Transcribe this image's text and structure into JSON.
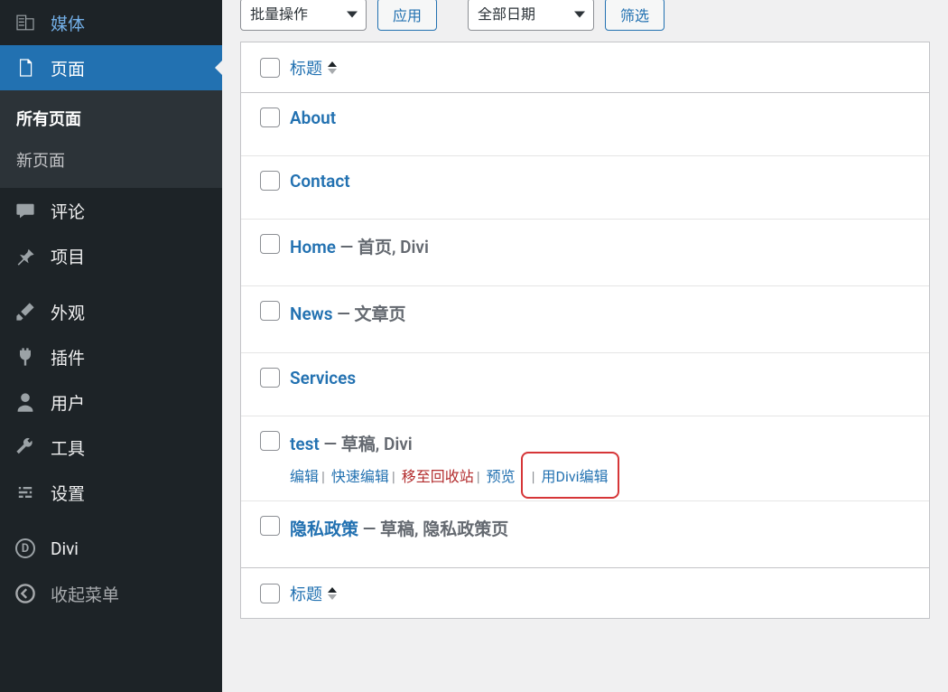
{
  "sidebar": {
    "items": [
      {
        "label": "媒体"
      },
      {
        "label": "页面"
      },
      {
        "label": "评论"
      },
      {
        "label": "项目"
      },
      {
        "label": "外观"
      },
      {
        "label": "插件"
      },
      {
        "label": "用户"
      },
      {
        "label": "工具"
      },
      {
        "label": "设置"
      },
      {
        "label": "Divi"
      },
      {
        "label": "收起菜单"
      }
    ],
    "submenu": {
      "all_pages": "所有页面",
      "new_page": "新页面"
    }
  },
  "toolbar": {
    "bulk_action": "批量操作",
    "apply": "应用",
    "all_dates": "全部日期",
    "filter": "筛选"
  },
  "table": {
    "title_header": "标题",
    "rows": [
      {
        "title": "About",
        "state": ""
      },
      {
        "title": "Contact",
        "state": ""
      },
      {
        "title": "Home",
        "state": " — 首页, Divi"
      },
      {
        "title": "News",
        "state": " — 文章页"
      },
      {
        "title": "Services",
        "state": ""
      },
      {
        "title": "test",
        "state": " — 草稿, Divi"
      },
      {
        "title": "隐私政策",
        "state": " — 草稿, 隐私政策页"
      }
    ],
    "row_actions": {
      "edit": "编辑",
      "quick_edit": "快速编辑",
      "trash": "移至回收站",
      "preview": "预览",
      "divi_edit": "用Divi编辑"
    }
  }
}
